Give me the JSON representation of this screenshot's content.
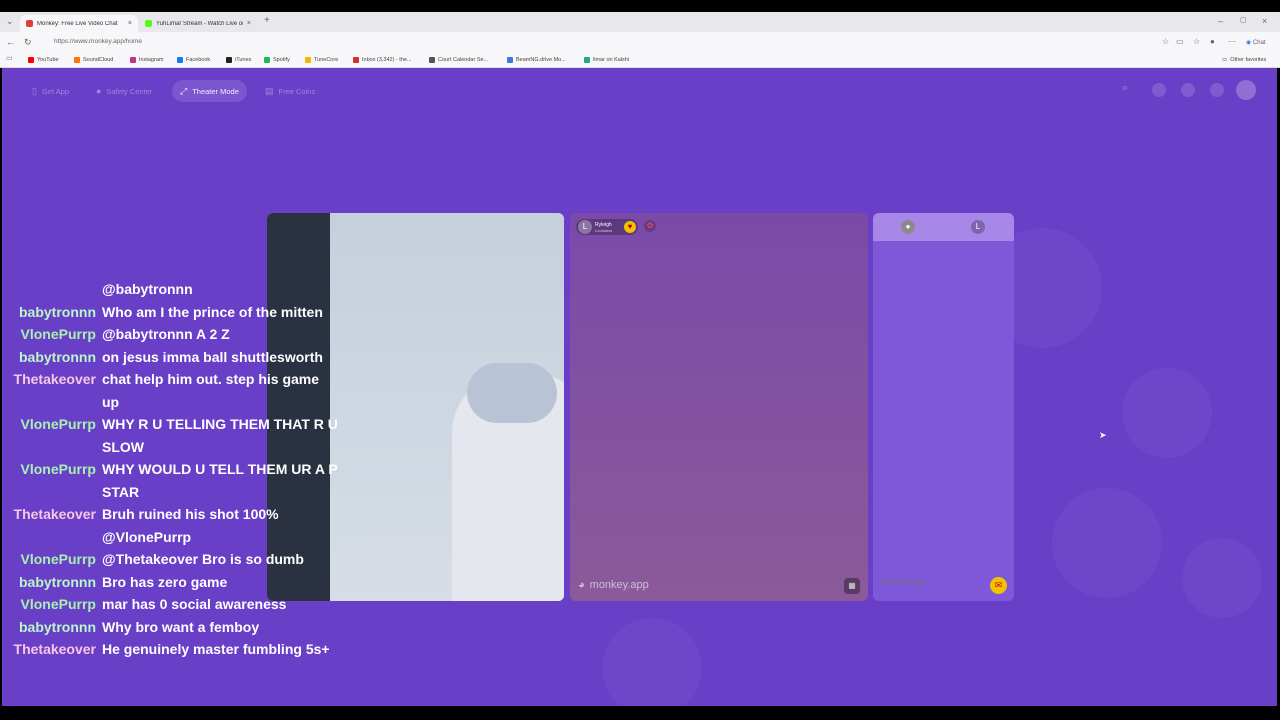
{
  "browser": {
    "tabs": [
      {
        "label": "Monkey: Free Live Video Chat",
        "active": true,
        "color": "#e23b3b"
      },
      {
        "label": "YuhLimar Stream - Watch Live on Kick",
        "active": false,
        "color": "#53fc18"
      }
    ],
    "new_tab": "+",
    "url": "https://www.monkey.app/home",
    "chat_button": "Chat",
    "bookmarks": [
      {
        "label": "YouTube",
        "color": "#ff0000"
      },
      {
        "label": "SoundCloud",
        "color": "#ff7700"
      },
      {
        "label": "Instagram",
        "color": "#c13584"
      },
      {
        "label": "Facebook",
        "color": "#1877f2"
      },
      {
        "label": "iTunes",
        "color": "#222222"
      },
      {
        "label": "Spotify",
        "color": "#1db954"
      },
      {
        "label": "TuneCore",
        "color": "#f5b800"
      },
      {
        "label": "Inbox (3,342) - the...",
        "color": "#d93025"
      },
      {
        "label": "Court Calendar Se...",
        "color": "#555555"
      },
      {
        "label": "BeamNG.drive Mo...",
        "color": "#3a7bd5"
      },
      {
        "label": "limar on Kalshi",
        "color": "#22aa88"
      }
    ],
    "other_favorites": "Other favorites"
  },
  "app": {
    "nav": [
      {
        "label": "Get App",
        "icon": "phone-icon"
      },
      {
        "label": "Safety Center",
        "icon": "shield-icon"
      },
      {
        "label": "Theater Mode",
        "icon": "expand-icon",
        "active": true
      },
      {
        "label": "Free Coins",
        "icon": "coin-icon"
      }
    ],
    "stranger_name": "Rylеigh",
    "stranger_location": "Louisiana",
    "stranger_avatar": "L",
    "watermark": "monkey.app",
    "chat_avatar_letter": "L",
    "send_placeholder": "Send Message",
    "brand_color": "#6a3fc8"
  },
  "stream_chat": [
    {
      "user": "",
      "message": "@babytronnn",
      "class": "u1"
    },
    {
      "user": "babytronnn",
      "message": "Who am I the prince of the mitten",
      "class": "u1"
    },
    {
      "user": "VlonePurrp",
      "message": "@babytronnn A 2 Z",
      "class": "u2"
    },
    {
      "user": "babytronnn",
      "message": "on jesus imma ball shuttlesworth",
      "class": "u1"
    },
    {
      "user": "Thetakeover",
      "message": "chat help him out. step his game\nup",
      "class": "u3"
    },
    {
      "user": "VlonePurrp",
      "message": "WHY R U TELLING THEM THAT R U\nSLOW",
      "class": "u2"
    },
    {
      "user": "VlonePurrp",
      "message": "WHY WOULD U TELL THEM UR A P\nSTAR",
      "class": "u2"
    },
    {
      "user": "Thetakeover",
      "message": "Bruh ruined his shot 100%\n@VlonePurrp",
      "class": "u3"
    },
    {
      "user": "VlonePurrp",
      "message": "@Thetakeover Bro is so dumb",
      "class": "u2"
    },
    {
      "user": "babytronnn",
      "message": "Bro has zero game",
      "class": "u1"
    },
    {
      "user": "VlonePurrp",
      "message": "mar has 0 social awareness",
      "class": "u2"
    },
    {
      "user": "babytronnn",
      "message": "Why bro want a femboy",
      "class": "u1"
    },
    {
      "user": "Thetakeover",
      "message": "He genuinely master fumbling 5s+",
      "class": "u3"
    }
  ]
}
